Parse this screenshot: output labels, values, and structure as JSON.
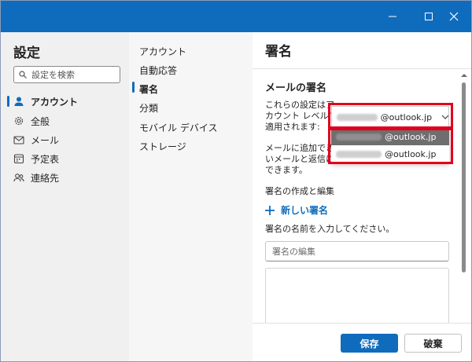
{
  "window": {
    "controls": {
      "minimize": "–",
      "maximize": "☐",
      "close": "✕"
    }
  },
  "nav": {
    "title": "設定",
    "search_placeholder": "設定を検索",
    "items": [
      {
        "label": "アカウント",
        "icon": "person-icon"
      },
      {
        "label": "全般",
        "icon": "gear-icon"
      },
      {
        "label": "メール",
        "icon": "mail-icon"
      },
      {
        "label": "予定表",
        "icon": "calendar-icon"
      },
      {
        "label": "連絡先",
        "icon": "people-icon"
      }
    ],
    "active_index": 0
  },
  "subnav": {
    "items": [
      {
        "label": "アカウント"
      },
      {
        "label": "自動応答"
      },
      {
        "label": "署名"
      },
      {
        "label": "分類"
      },
      {
        "label": "モバイル デバイス"
      },
      {
        "label": "ストレージ"
      }
    ],
    "active_index": 2
  },
  "main": {
    "title": "署名",
    "section_title": "メールの署名",
    "apply_text": [
      "これらの設定はア",
      "カウント レベルで",
      "適用されます:"
    ],
    "selected_account_domain": "@outlook.jp",
    "dropdown_options": [
      {
        "domain": "@outlook.jp"
      },
      {
        "domain": "@outlook.jp"
      }
    ],
    "info_text": [
      "メールに追加できる署",
      "いメールと返信に既定",
      "できます。"
    ],
    "create_edit_label": "署名の作成と編集",
    "new_signature_label": "新しい署名",
    "name_prompt": "署名の名前を入力してください。",
    "name_input_placeholder": "署名の編集"
  },
  "footer": {
    "save_label": "保存",
    "discard_label": "破棄"
  },
  "colors": {
    "accent": "#0f6cbd",
    "highlight_box": "#e0001b"
  }
}
